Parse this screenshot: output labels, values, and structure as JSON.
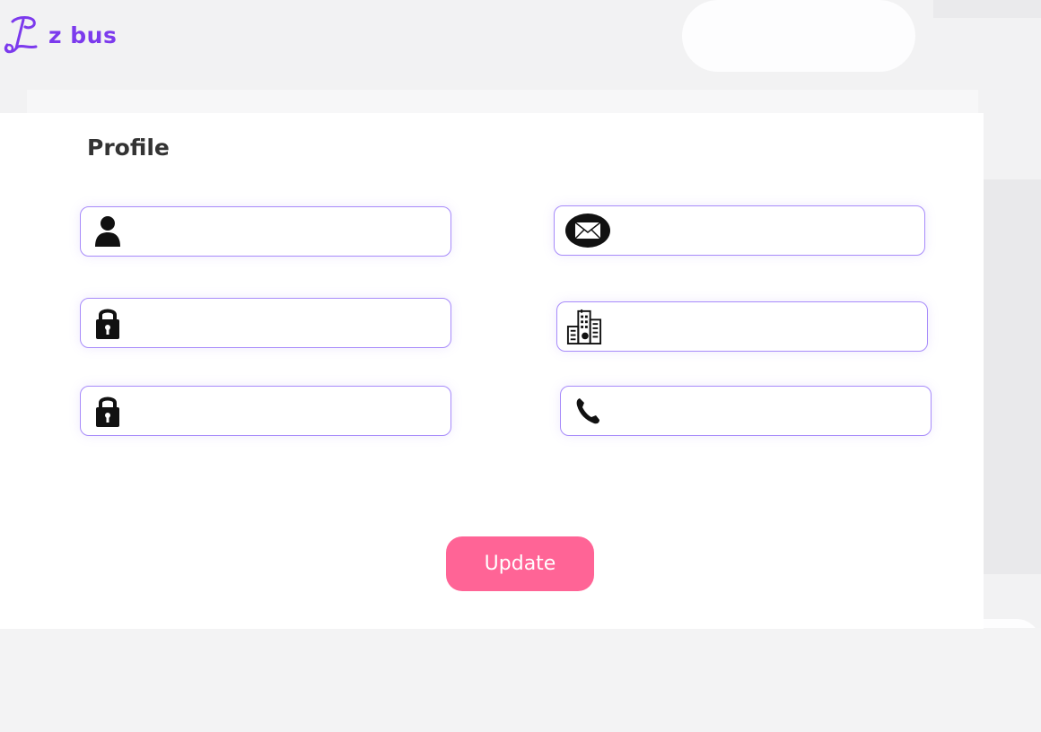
{
  "brand": {
    "name": "z bus",
    "color": "#7c3aed"
  },
  "page": {
    "title": "Profile"
  },
  "fields": [
    {
      "id": "name",
      "icon": "user-icon",
      "value": "",
      "placeholder": ""
    },
    {
      "id": "email",
      "icon": "envelope-icon",
      "value": "",
      "placeholder": ""
    },
    {
      "id": "password",
      "icon": "lock-icon",
      "value": "",
      "placeholder": ""
    },
    {
      "id": "company",
      "icon": "building-icon",
      "value": "",
      "placeholder": ""
    },
    {
      "id": "confirm_password",
      "icon": "lock-icon",
      "value": "",
      "placeholder": ""
    },
    {
      "id": "phone",
      "icon": "phone-icon",
      "value": "",
      "placeholder": ""
    }
  ],
  "actions": {
    "update_label": "Update",
    "update_color": "#ff6496"
  },
  "colors": {
    "field_border": "#a78bfa",
    "background": "#f2f2f3"
  }
}
